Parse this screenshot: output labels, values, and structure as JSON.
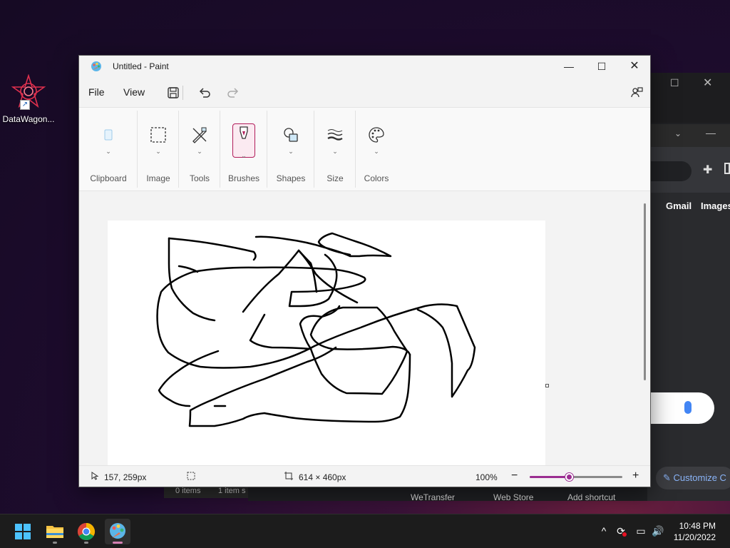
{
  "desktop": {
    "icon_label": "DataWagon..."
  },
  "background_browser": {
    "links": [
      "Gmail",
      "Images"
    ],
    "customize_label": "Customize C",
    "shortcuts": [
      "WeTransfer",
      "Web Store",
      "Add shortcut"
    ],
    "files_status": [
      "0 items",
      "1 item s"
    ]
  },
  "paint": {
    "title": "Untitled - Paint",
    "menu": {
      "file": "File",
      "view": "View"
    },
    "ribbon": {
      "clipboard": "Clipboard",
      "image": "Image",
      "tools": "Tools",
      "brushes": "Brushes",
      "shapes": "Shapes",
      "size": "Size",
      "colors": "Colors"
    },
    "status": {
      "cursor_position": "157, 259px",
      "canvas_size": "614 × 460px",
      "zoom_label": "100%",
      "zoom_fraction": 0.42
    },
    "accent_color": "#9b2d91"
  },
  "taskbar": {
    "apps": [
      "start-icon",
      "file-explorer-icon",
      "chrome-icon",
      "paint-icon"
    ],
    "time": "10:48 PM",
    "date": "11/20/2022"
  }
}
